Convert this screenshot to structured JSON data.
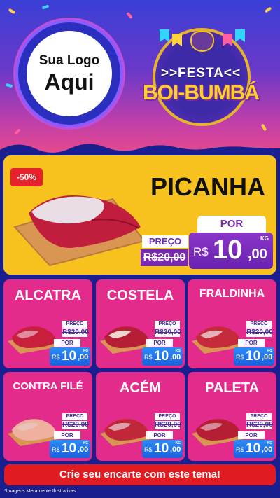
{
  "header": {
    "logo_line1": "Sua Logo",
    "logo_line2": "Aqui",
    "festa_line1": ">>FESTA<<",
    "festa_line2": "BOI-BUMBÁ"
  },
  "featured": {
    "discount": "-50%",
    "name": "PICANHA",
    "por_label": "POR",
    "preco_label": "PREÇO",
    "old_price": "R$20,00",
    "currency": "R$",
    "price_main": "10",
    "price_cents": ",00",
    "unit": "KG"
  },
  "products": [
    {
      "name": "ALCATRA",
      "preco_label": "PREÇO",
      "old_price": "R$20,00",
      "por_label": "POR",
      "currency": "R$",
      "price_main": "10",
      "price_cents": ",00",
      "unit": "KG"
    },
    {
      "name": "COSTELA",
      "preco_label": "PREÇO",
      "old_price": "R$20,00",
      "por_label": "POR",
      "currency": "R$",
      "price_main": "10",
      "price_cents": ",00",
      "unit": "KG"
    },
    {
      "name": "FRALDINHA",
      "preco_label": "PREÇO",
      "old_price": "R$20,00",
      "por_label": "POR",
      "currency": "R$",
      "price_main": "10",
      "price_cents": ",00",
      "unit": "KG"
    },
    {
      "name": "CONTRA FILÉ",
      "preco_label": "PREÇO",
      "old_price": "R$20,00",
      "por_label": "POR",
      "currency": "R$",
      "price_main": "10",
      "price_cents": ",00",
      "unit": "KG"
    },
    {
      "name": "ACÉM",
      "preco_label": "PREÇO",
      "old_price": "R$20,00",
      "por_label": "POR",
      "currency": "R$",
      "price_main": "10",
      "price_cents": ",00",
      "unit": "KG"
    },
    {
      "name": "PALETA",
      "preco_label": "PREÇO",
      "old_price": "R$20,00",
      "por_label": "POR",
      "currency": "R$",
      "price_main": "10",
      "price_cents": ",00",
      "unit": "KG"
    }
  ],
  "cta": "Crie seu encarte com este tema!",
  "disclaimer": "*Imagens Meramente Ilustrativas",
  "colors": {
    "featured_bg": "#f7c21e",
    "card_bg": "#e22b8a",
    "price_tag": "#2e8cf5",
    "featured_price": "#7a2ab2",
    "cta_bg": "#e11b22"
  }
}
